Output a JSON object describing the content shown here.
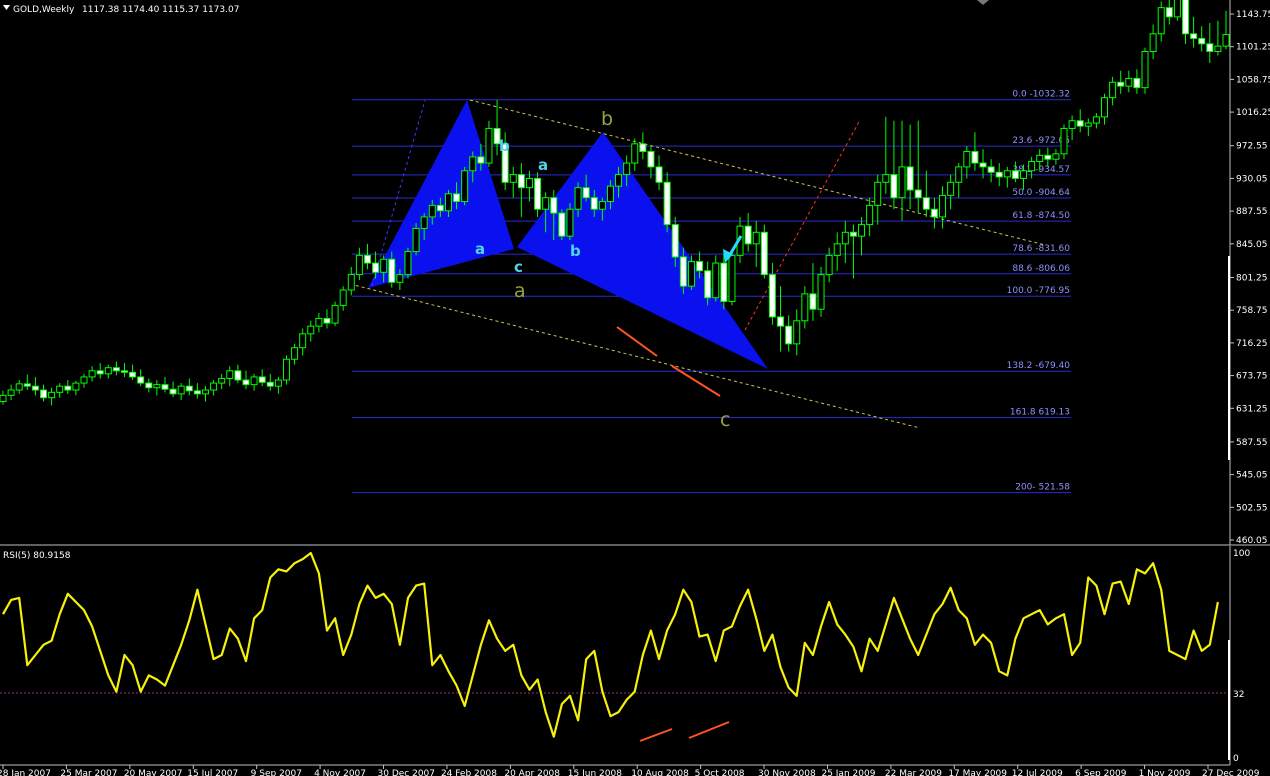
{
  "header": {
    "symbol": "GOLD,Weekly",
    "ohlc": "1117.38 1174.40 1115.37 1173.07"
  },
  "indicator": {
    "label": "RSI(5) 80.9158",
    "levels": [
      "100",
      "32",
      "0"
    ]
  },
  "colors": {
    "background": "#000000",
    "candle": "#00ff00",
    "candle_body_up": "#000000",
    "candle_body_down": "#ffffff",
    "fib_line": "#2b2bd0",
    "harmonic_fill": "#0a10ee",
    "rsi_line": "#f5f10a",
    "divergence": "#ff5522",
    "channel": "#c8c850",
    "arrow": "#22ddff"
  },
  "icons": {
    "signal": "arrow-down-left-icon"
  },
  "chart_data": {
    "type": "candlestick",
    "y_ticks": [
      "1143.75",
      "1101.25",
      "1058.75",
      "1016.25",
      "972.55",
      "930.05",
      "887.55",
      "845.05",
      "801.25",
      "758.75",
      "716.25",
      "673.75",
      "631.25",
      "587.55",
      "545.05",
      "502.55",
      "460.05"
    ],
    "x_ticks": [
      "28 Jan 2007",
      "25 Mar 2007",
      "20 May 2007",
      "15 Jul 2007",
      "9 Sep 2007",
      "4 Nov 2007",
      "30 Dec 2007",
      "24 Feb 2008",
      "20 Apr 2008",
      "15 Jun 2008",
      "10 Aug 2008",
      "5 Oct 2008",
      "30 Nov 2008",
      "25 Jan 2009",
      "22 Mar 2009",
      "17 May 2009",
      "12 Jul 2009",
      "6 Sep 2009",
      "1 Nov 2009",
      "27 Dec 2009"
    ],
    "fib_levels": [
      {
        "label": "0.0 -1032.32",
        "value": 1032.32
      },
      {
        "label": "23.6 -972.05",
        "value": 972.05
      },
      {
        "label": "38.2 -934.57",
        "value": 934.57
      },
      {
        "label": "50.0 -904.64",
        "value": 904.64
      },
      {
        "label": "61.8 -874.50",
        "value": 874.5
      },
      {
        "label": "78.6 -831.60",
        "value": 831.6
      },
      {
        "label": "88.6 -806.06",
        "value": 806.06
      },
      {
        "label": "100.0 -776.95",
        "value": 776.95
      },
      {
        "label": "138.2 -679.40",
        "value": 679.4
      },
      {
        "label": "161.8 619.13",
        "value": 619.13
      },
      {
        "label": "200- 521.58",
        "value": 521.58
      }
    ],
    "pattern_labels": [
      "b",
      "a",
      "b",
      "a",
      "c",
      "b",
      "a",
      "b",
      "c"
    ],
    "series": [
      {
        "name": "GOLD,Weekly",
        "values": [
          [
            640,
            654,
            636,
            648
          ],
          [
            648,
            662,
            642,
            655
          ],
          [
            655,
            668,
            650,
            663
          ],
          [
            663,
            675,
            655,
            660
          ],
          [
            660,
            672,
            648,
            655
          ],
          [
            655,
            662,
            640,
            645
          ],
          [
            645,
            658,
            635,
            652
          ],
          [
            652,
            664,
            645,
            660
          ],
          [
            660,
            668,
            650,
            655
          ],
          [
            655,
            667,
            648,
            664
          ],
          [
            664,
            676,
            658,
            672
          ],
          [
            672,
            686,
            666,
            680
          ],
          [
            680,
            690,
            670,
            676
          ],
          [
            676,
            688,
            670,
            684
          ],
          [
            684,
            692,
            674,
            680
          ],
          [
            680,
            690,
            672,
            678
          ],
          [
            678,
            688,
            668,
            672
          ],
          [
            672,
            682,
            660,
            664
          ],
          [
            664,
            670,
            652,
            658
          ],
          [
            658,
            668,
            648,
            662
          ],
          [
            662,
            672,
            652,
            656
          ],
          [
            656,
            666,
            646,
            650
          ],
          [
            650,
            664,
            642,
            660
          ],
          [
            660,
            670,
            648,
            654
          ],
          [
            654,
            664,
            644,
            650
          ],
          [
            650,
            660,
            640,
            655
          ],
          [
            655,
            668,
            648,
            664
          ],
          [
            664,
            676,
            656,
            670
          ],
          [
            670,
            686,
            660,
            680
          ],
          [
            680,
            688,
            664,
            668
          ],
          [
            668,
            680,
            656,
            662
          ],
          [
            662,
            676,
            654,
            672
          ],
          [
            672,
            682,
            660,
            665
          ],
          [
            665,
            676,
            654,
            660
          ],
          [
            660,
            672,
            650,
            668
          ],
          [
            668,
            700,
            662,
            695
          ],
          [
            695,
            715,
            688,
            710
          ],
          [
            710,
            735,
            700,
            728
          ],
          [
            728,
            745,
            718,
            738
          ],
          [
            738,
            755,
            730,
            748
          ],
          [
            748,
            760,
            735,
            742
          ],
          [
            742,
            770,
            738,
            765
          ],
          [
            765,
            790,
            758,
            785
          ],
          [
            785,
            815,
            778,
            805
          ],
          [
            805,
            840,
            798,
            830
          ],
          [
            830,
            845,
            812,
            820
          ],
          [
            820,
            835,
            800,
            808
          ],
          [
            808,
            830,
            795,
            825
          ],
          [
            825,
            835,
            788,
            795
          ],
          [
            795,
            812,
            785,
            805
          ],
          [
            805,
            840,
            800,
            835
          ],
          [
            835,
            872,
            830,
            865
          ],
          [
            865,
            885,
            850,
            880
          ],
          [
            880,
            902,
            870,
            895
          ],
          [
            895,
            905,
            880,
            888
          ],
          [
            888,
            915,
            880,
            910
          ],
          [
            910,
            925,
            890,
            900
          ],
          [
            900,
            945,
            895,
            940
          ],
          [
            940,
            965,
            925,
            958
          ],
          [
            958,
            975,
            940,
            950
          ],
          [
            950,
            1005,
            945,
            995
          ],
          [
            995,
            1032,
            960,
            975
          ],
          [
            975,
            990,
            915,
            925
          ],
          [
            925,
            945,
            905,
            935
          ],
          [
            935,
            950,
            880,
            918
          ],
          [
            918,
            940,
            900,
            930
          ],
          [
            930,
            938,
            880,
            890
          ],
          [
            890,
            912,
            860,
            905
          ],
          [
            905,
            915,
            850,
            885
          ],
          [
            885,
            890,
            850,
            855
          ],
          [
            855,
            898,
            850,
            890
          ],
          [
            890,
            925,
            880,
            918
          ],
          [
            918,
            935,
            900,
            905
          ],
          [
            905,
            915,
            880,
            890
          ],
          [
            890,
            905,
            875,
            900
          ],
          [
            900,
            928,
            890,
            920
          ],
          [
            920,
            945,
            905,
            935
          ],
          [
            935,
            960,
            920,
            950
          ],
          [
            950,
            982,
            940,
            975
          ],
          [
            975,
            990,
            955,
            965
          ],
          [
            965,
            972,
            930,
            945
          ],
          [
            945,
            960,
            915,
            925
          ],
          [
            925,
            938,
            860,
            870
          ],
          [
            870,
            880,
            815,
            828
          ],
          [
            828,
            840,
            780,
            790
          ],
          [
            790,
            830,
            785,
            822
          ],
          [
            822,
            835,
            800,
            810
          ],
          [
            810,
            822,
            765,
            775
          ],
          [
            775,
            830,
            770,
            820
          ],
          [
            820,
            835,
            760,
            770
          ],
          [
            770,
            838,
            765,
            830
          ],
          [
            830,
            880,
            820,
            868
          ],
          [
            868,
            885,
            835,
            845
          ],
          [
            845,
            875,
            815,
            860
          ],
          [
            860,
            870,
            800,
            805
          ],
          [
            805,
            820,
            740,
            750
          ],
          [
            750,
            790,
            705,
            738
          ],
          [
            738,
            752,
            705,
            715
          ],
          [
            715,
            760,
            700,
            745
          ],
          [
            745,
            790,
            735,
            780
          ],
          [
            780,
            820,
            745,
            760
          ],
          [
            760,
            815,
            750,
            805
          ],
          [
            805,
            840,
            795,
            830
          ],
          [
            830,
            860,
            810,
            845
          ],
          [
            845,
            875,
            820,
            860
          ],
          [
            860,
            870,
            800,
            855
          ],
          [
            855,
            880,
            830,
            870
          ],
          [
            870,
            905,
            855,
            895
          ],
          [
            895,
            935,
            870,
            925
          ],
          [
            925,
            1010,
            910,
            935
          ],
          [
            935,
            1005,
            890,
            905
          ],
          [
            905,
            1005,
            875,
            945
          ],
          [
            945,
            1000,
            890,
            915
          ],
          [
            915,
            1005,
            885,
            905
          ],
          [
            905,
            940,
            880,
            890
          ],
          [
            890,
            905,
            865,
            880
          ],
          [
            880,
            920,
            865,
            908
          ],
          [
            908,
            935,
            890,
            925
          ],
          [
            925,
            950,
            905,
            945
          ],
          [
            945,
            972,
            930,
            965
          ],
          [
            965,
            990,
            940,
            950
          ],
          [
            950,
            968,
            930,
            945
          ],
          [
            945,
            955,
            925,
            938
          ],
          [
            938,
            950,
            920,
            932
          ],
          [
            932,
            945,
            918,
            940
          ],
          [
            940,
            952,
            925,
            930
          ],
          [
            930,
            948,
            915,
            940
          ],
          [
            940,
            958,
            930,
            952
          ],
          [
            952,
            968,
            940,
            960
          ],
          [
            960,
            970,
            945,
            955
          ],
          [
            955,
            968,
            948,
            962
          ],
          [
            962,
            1000,
            955,
            995
          ],
          [
            995,
            1012,
            980,
            1005
          ],
          [
            1005,
            1020,
            990,
            998
          ],
          [
            998,
            1008,
            985,
            1002
          ],
          [
            1002,
            1015,
            995,
            1010
          ],
          [
            1010,
            1040,
            1000,
            1035
          ],
          [
            1035,
            1062,
            1025,
            1055
          ],
          [
            1055,
            1070,
            1040,
            1050
          ],
          [
            1050,
            1070,
            1042,
            1060
          ],
          [
            1060,
            1072,
            1040,
            1048
          ],
          [
            1048,
            1100,
            1040,
            1095
          ],
          [
            1095,
            1130,
            1085,
            1118
          ],
          [
            1118,
            1160,
            1108,
            1152
          ],
          [
            1152,
            1170,
            1130,
            1140
          ],
          [
            1140,
            1226,
            1135,
            1170
          ],
          [
            1170,
            1215,
            1105,
            1118
          ],
          [
            1118,
            1140,
            1100,
            1112
          ],
          [
            1112,
            1128,
            1095,
            1105
          ],
          [
            1105,
            1132,
            1080,
            1095
          ],
          [
            1095,
            1135,
            1090,
            1102
          ],
          [
            1102,
            1148,
            1098,
            1117
          ]
        ]
      },
      {
        "name": "RSI(5) 80.9158",
        "values": [
          70,
          77,
          78,
          45,
          50,
          55,
          57,
          70,
          80,
          76,
          72,
          64,
          52,
          40,
          32,
          50,
          45,
          32,
          40,
          38,
          35,
          45,
          55,
          67,
          82,
          65,
          48,
          50,
          63,
          58,
          47,
          68,
          72,
          88,
          92,
          91,
          95,
          97,
          100,
          90,
          62,
          68,
          50,
          60,
          75,
          84,
          78,
          80,
          75,
          55,
          78,
          84,
          85,
          45,
          50,
          42,
          35,
          25,
          40,
          55,
          67,
          58,
          52,
          55,
          40,
          33,
          38,
          22,
          10,
          26,
          30,
          18,
          48,
          52,
          32,
          20,
          22,
          28,
          32,
          50,
          62,
          48,
          62,
          70,
          82,
          76,
          59,
          60,
          47,
          62,
          64,
          74,
          82,
          68,
          52,
          60,
          44,
          34,
          30,
          56,
          50,
          64,
          76,
          65,
          60,
          54,
          42,
          58,
          52,
          65,
          78,
          68,
          58,
          50,
          60,
          70,
          75,
          83,
          72,
          68,
          55,
          60,
          56,
          42,
          40,
          58,
          68,
          70,
          72,
          65,
          68,
          70,
          50,
          56,
          88,
          84,
          70,
          85,
          86,
          75,
          92,
          90,
          95,
          82,
          52,
          50,
          48,
          62,
          52,
          55,
          76
        ]
      }
    ]
  }
}
